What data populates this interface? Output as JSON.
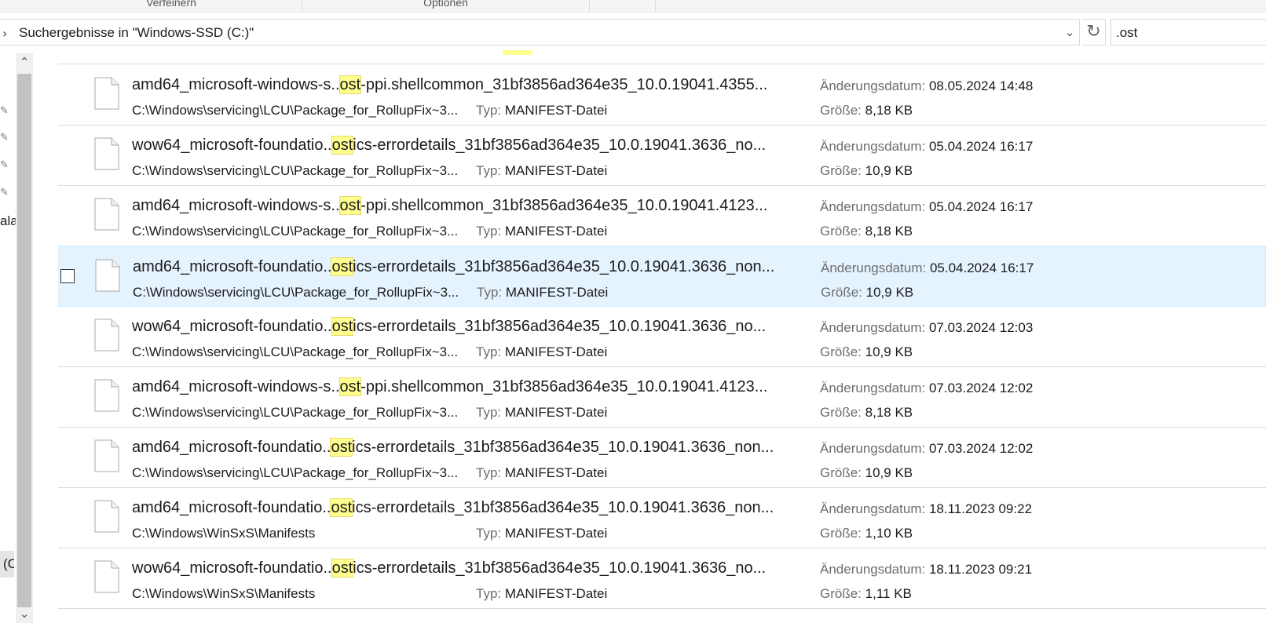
{
  "ribbon": {
    "groups": [
      "Verfeinern",
      "Optionen"
    ]
  },
  "address_bar": {
    "path_text": "Suchergebnisse in \"Windows-SSD (C:)\"",
    "dropdown_icon": "chevron-down-icon",
    "refresh_icon": "refresh-icon"
  },
  "search": {
    "value": ".ost"
  },
  "nav": {
    "fragment": "ala",
    "selected_fragment": "(C"
  },
  "labels": {
    "type": "Typ:",
    "modified": "Änderungsdatum:",
    "size": "Größe:"
  },
  "results": [
    {
      "name_pre": "amd64_microsoft-windows-s..",
      "name_match": "ost",
      "name_post": "-ppi.shellcommon_31bf3856ad364e35_10.0.19041.4355...",
      "path": "C:\\Windows\\servicing\\LCU\\Package_for_RollupFix~3...",
      "type": "MANIFEST-Datei",
      "modified": "08.05.2024 14:48",
      "size": "8,18 KB"
    },
    {
      "name_pre": "wow64_microsoft-foundatio..",
      "name_match": "ost",
      "name_post": "ics-errordetails_31bf3856ad364e35_10.0.19041.3636_no...",
      "path": "C:\\Windows\\servicing\\LCU\\Package_for_RollupFix~3...",
      "type": "MANIFEST-Datei",
      "modified": "05.04.2024 16:17",
      "size": "10,9 KB"
    },
    {
      "name_pre": "amd64_microsoft-windows-s..",
      "name_match": "ost",
      "name_post": "-ppi.shellcommon_31bf3856ad364e35_10.0.19041.4123...",
      "path": "C:\\Windows\\servicing\\LCU\\Package_for_RollupFix~3...",
      "type": "MANIFEST-Datei",
      "modified": "05.04.2024 16:17",
      "size": "8,18 KB"
    },
    {
      "name_pre": "amd64_microsoft-foundatio..",
      "name_match": "ost",
      "name_post": "ics-errordetails_31bf3856ad364e35_10.0.19041.3636_non...",
      "path": "C:\\Windows\\servicing\\LCU\\Package_for_RollupFix~3...",
      "type": "MANIFEST-Datei",
      "modified": "05.04.2024 16:17",
      "size": "10,9 KB",
      "selected": true
    },
    {
      "name_pre": "wow64_microsoft-foundatio..",
      "name_match": "ost",
      "name_post": "ics-errordetails_31bf3856ad364e35_10.0.19041.3636_no...",
      "path": "C:\\Windows\\servicing\\LCU\\Package_for_RollupFix~3...",
      "type": "MANIFEST-Datei",
      "modified": "07.03.2024 12:03",
      "size": "10,9 KB"
    },
    {
      "name_pre": "amd64_microsoft-windows-s..",
      "name_match": "ost",
      "name_post": "-ppi.shellcommon_31bf3856ad364e35_10.0.19041.4123...",
      "path": "C:\\Windows\\servicing\\LCU\\Package_for_RollupFix~3...",
      "type": "MANIFEST-Datei",
      "modified": "07.03.2024 12:02",
      "size": "8,18 KB"
    },
    {
      "name_pre": "amd64_microsoft-foundatio..",
      "name_match": "ost",
      "name_post": "ics-errordetails_31bf3856ad364e35_10.0.19041.3636_non...",
      "path": "C:\\Windows\\servicing\\LCU\\Package_for_RollupFix~3...",
      "type": "MANIFEST-Datei",
      "modified": "07.03.2024 12:02",
      "size": "10,9 KB"
    },
    {
      "name_pre": "amd64_microsoft-foundatio..",
      "name_match": "ost",
      "name_post": "ics-errordetails_31bf3856ad364e35_10.0.19041.3636_non...",
      "path": "C:\\Windows\\WinSxS\\Manifests",
      "type": "MANIFEST-Datei",
      "modified": "18.11.2023 09:22",
      "size": "1,10 KB"
    },
    {
      "name_pre": "wow64_microsoft-foundatio..",
      "name_match": "ost",
      "name_post": "ics-errordetails_31bf3856ad364e35_10.0.19041.3636_no...",
      "path": "C:\\Windows\\WinSxS\\Manifests",
      "type": "MANIFEST-Datei",
      "modified": "18.11.2023 09:21",
      "size": "1,11 KB"
    }
  ]
}
